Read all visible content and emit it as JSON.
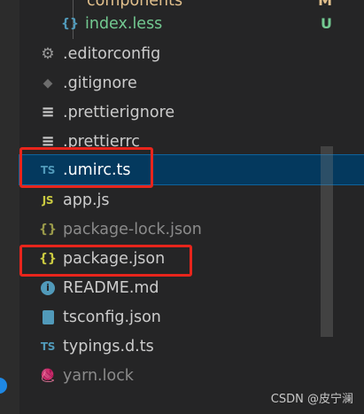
{
  "explorer": {
    "items": [
      {
        "label": "components",
        "icon": "folder-icon",
        "suffix": "M"
      },
      {
        "label": "index.less",
        "icon": "less-file-icon",
        "glyph": "{}",
        "suffix": "U"
      },
      {
        "label": ".editorconfig",
        "icon": "gear-icon",
        "glyph": "⚙"
      },
      {
        "label": ".gitignore",
        "icon": "git-icon",
        "glyph": "◆"
      },
      {
        "label": ".prettierignore",
        "icon": "lines-icon",
        "glyph": "≡"
      },
      {
        "label": ".prettierrc",
        "icon": "lines-icon",
        "glyph": "≡"
      },
      {
        "label": ".umirc.ts",
        "icon": "typescript-icon",
        "glyph": "TS"
      },
      {
        "label": "app.js",
        "icon": "javascript-icon",
        "glyph": "JS"
      },
      {
        "label": "package-lock.json",
        "icon": "json-icon",
        "glyph": "{}"
      },
      {
        "label": "package.json",
        "icon": "json-icon",
        "glyph": "{}"
      },
      {
        "label": "README.md",
        "icon": "info-icon",
        "glyph": "i"
      },
      {
        "label": "tsconfig.json",
        "icon": "tsconfig-icon"
      },
      {
        "label": "typings.d.ts",
        "icon": "typescript-icon",
        "glyph": "TS"
      },
      {
        "label": "yarn.lock",
        "icon": "yarn-icon",
        "glyph": "🧶"
      }
    ]
  },
  "colors": {
    "background": "#252526",
    "selected_row": "#04395e",
    "highlight_box": "#e8251c",
    "modified": "#e2c08d",
    "untracked": "#73c991"
  },
  "watermark": "CSDN @皮宁澜"
}
